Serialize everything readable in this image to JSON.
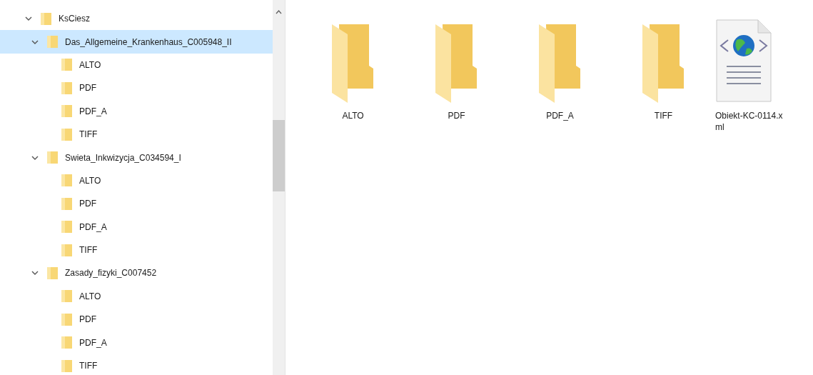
{
  "tree": [
    {
      "label": "KsCiesz",
      "expanded": true,
      "selected": false,
      "children": [
        {
          "label": "Das_Allgemeine_Krankenhaus_C005948_II",
          "expanded": true,
          "selected": true,
          "children": [
            {
              "label": "ALTO",
              "selected": false
            },
            {
              "label": "PDF",
              "selected": false
            },
            {
              "label": "PDF_A",
              "selected": false
            },
            {
              "label": "TIFF",
              "selected": false
            }
          ]
        },
        {
          "label": "Swieta_Inkwizycja_C034594_I",
          "expanded": true,
          "selected": false,
          "children": [
            {
              "label": "ALTO",
              "selected": false
            },
            {
              "label": "PDF",
              "selected": false
            },
            {
              "label": "PDF_A",
              "selected": false
            },
            {
              "label": "TIFF",
              "selected": false
            }
          ]
        },
        {
          "label": "Zasady_fizyki_C007452",
          "expanded": true,
          "selected": false,
          "children": [
            {
              "label": "ALTO",
              "selected": false
            },
            {
              "label": "PDF",
              "selected": false
            },
            {
              "label": "PDF_A",
              "selected": false
            },
            {
              "label": "TIFF",
              "selected": false
            }
          ]
        }
      ]
    }
  ],
  "items": [
    {
      "kind": "folder",
      "name": "ALTO"
    },
    {
      "kind": "folder",
      "name": "PDF"
    },
    {
      "kind": "folder",
      "name": "PDF_A"
    },
    {
      "kind": "folder",
      "name": "TIFF"
    },
    {
      "kind": "xml",
      "name_lines": [
        "Obiekt-KC-0114.x",
        "ml"
      ]
    }
  ]
}
